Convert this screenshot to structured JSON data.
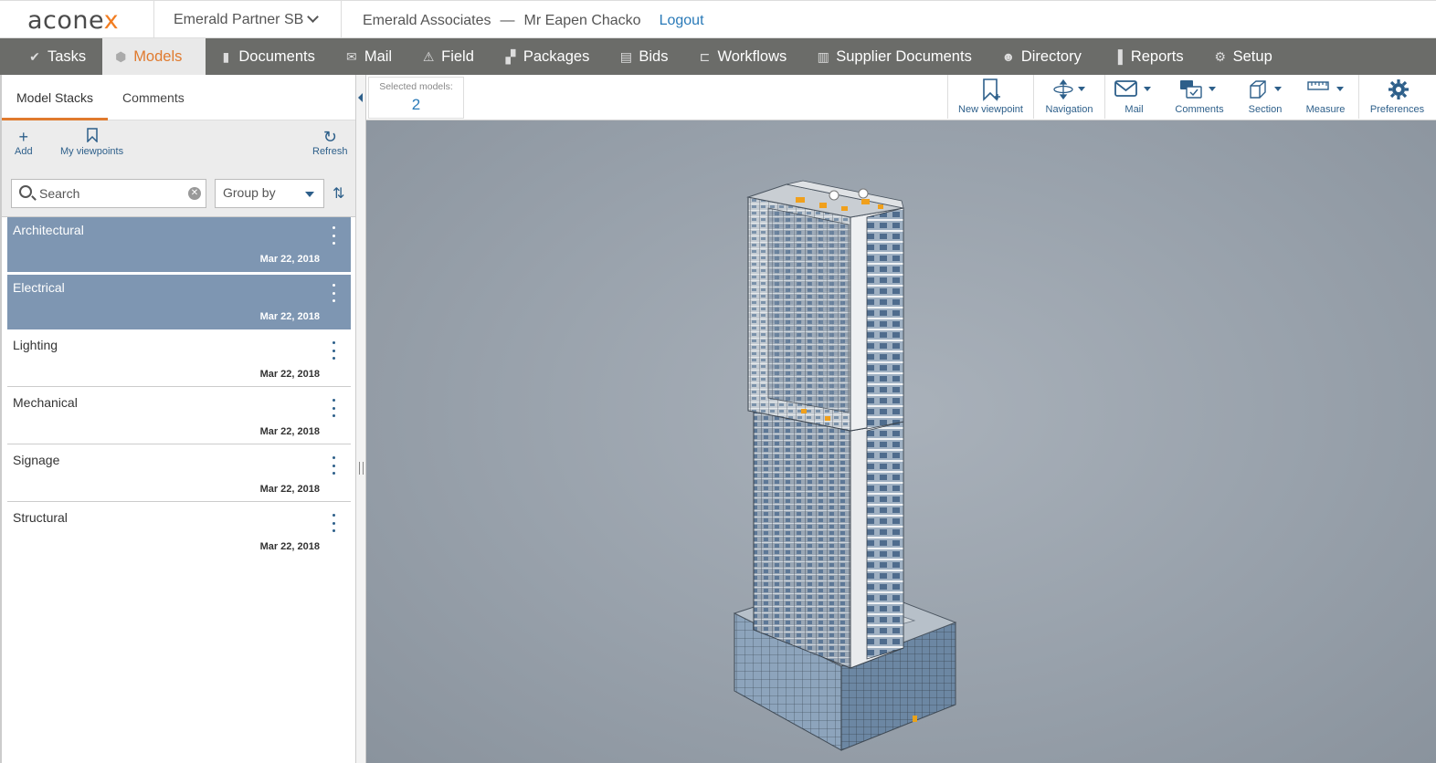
{
  "header": {
    "logo_main": "acone",
    "logo_x": "x",
    "organization": "Emerald Partner SB",
    "project": "Emerald Associates",
    "separator": "—",
    "user": "Mr Eapen Chacko",
    "logout_label": "Logout"
  },
  "nav": {
    "items": [
      {
        "label": "Tasks",
        "icon": "check-icon"
      },
      {
        "label": "Models",
        "icon": "cube-icon"
      },
      {
        "label": "Documents",
        "icon": "document-icon"
      },
      {
        "label": "Mail",
        "icon": "envelope-icon"
      },
      {
        "label": "Field",
        "icon": "warning-icon"
      },
      {
        "label": "Packages",
        "icon": "packages-icon"
      },
      {
        "label": "Bids",
        "icon": "bids-icon"
      },
      {
        "label": "Workflows",
        "icon": "workflow-icon"
      },
      {
        "label": "Supplier Documents",
        "icon": "building-icon"
      },
      {
        "label": "Directory",
        "icon": "people-icon"
      },
      {
        "label": "Reports",
        "icon": "bar-chart-icon"
      },
      {
        "label": "Setup",
        "icon": "gear-icon"
      }
    ],
    "active": "Models"
  },
  "left_panel": {
    "tabs": [
      "Model Stacks",
      "Comments"
    ],
    "active_tab": "Model Stacks",
    "toolbar": {
      "add_label": "Add",
      "viewpoints_label": "My viewpoints",
      "refresh_label": "Refresh"
    },
    "search": {
      "placeholder": "Search",
      "value": ""
    },
    "group_by": {
      "label": "Group by"
    },
    "models": [
      {
        "name": "Architectural",
        "date": "Mar 22, 2018",
        "selected": true
      },
      {
        "name": "Electrical",
        "date": "Mar 22, 2018",
        "selected": true
      },
      {
        "name": "Lighting",
        "date": "Mar 22, 2018",
        "selected": false
      },
      {
        "name": "Mechanical",
        "date": "Mar 22, 2018",
        "selected": false
      },
      {
        "name": "Signage",
        "date": "Mar 22, 2018",
        "selected": false
      },
      {
        "name": "Structural",
        "date": "Mar 22, 2018",
        "selected": false
      }
    ]
  },
  "viewer_toolbar": {
    "selected_models_label": "Selected models:",
    "selected_models_count": "2",
    "buttons": {
      "new_viewpoint": "New viewpoint",
      "navigation": "Navigation",
      "mail": "Mail",
      "comments": "Comments",
      "section": "Section",
      "measure": "Measure",
      "preferences": "Preferences"
    }
  },
  "colors": {
    "nav_bg": "#6b6c69",
    "accent_orange": "#e07a2e",
    "link_blue": "#2a7ab8",
    "icon_blue": "#2d5f8a",
    "selected_row": "#7e96b2",
    "viewport_bg": "#98a1ab"
  }
}
